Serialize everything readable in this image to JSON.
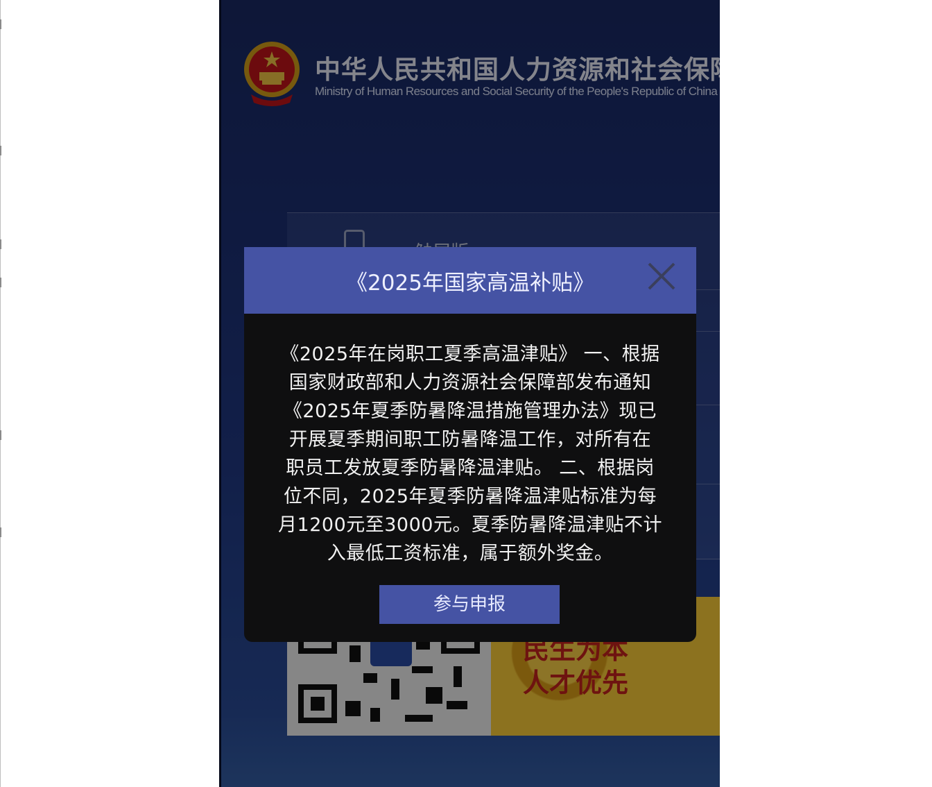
{
  "header": {
    "title_cn": "中华人民共和国人力资源和社会保障部",
    "title_en": "Ministry of Human Resources and Social Security of the People's Republic of China"
  },
  "background": {
    "tab_label": "触屏版"
  },
  "dialog": {
    "title": "《2025年国家高温补贴》",
    "body_lines": [
      "《2025年在岗职工夏季高温津贴》 一、根据",
      "国家财政部和人力资源社会保障部发布通知",
      "《2025年夏季防暑降温措施管理办法》现已",
      "开展夏季期间职工防暑降温工作，对所有在",
      "职员工发放夏季防暑降温津贴。 二、根据岗",
      "位不同，2025年夏季防暑降温津贴标准为每",
      "月1200元至3000元。夏季防暑降温津贴不计",
      "入最低工资标准，属于额外奖金。"
    ],
    "button_label": "参与申报"
  },
  "promo": {
    "line1": "民生为本",
    "line2": "人才优先"
  },
  "colors": {
    "accent": "#4553a4",
    "dialog_bg": "#0f0f10",
    "page_bg": "#1d3176"
  }
}
